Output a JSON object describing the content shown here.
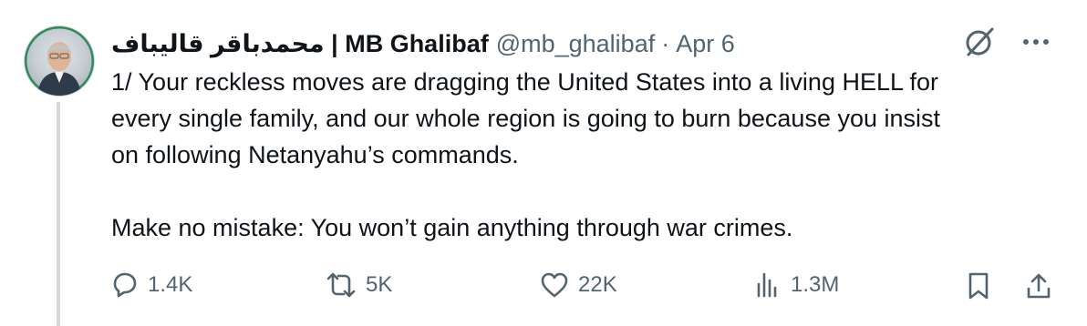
{
  "tweet": {
    "author": {
      "display_name": "محمدباقر قالیباف | MB Ghalibaf",
      "handle": "@mb_ghalibaf",
      "separator": "·",
      "date": "Apr 6"
    },
    "body": [
      "1/ Your reckless moves are dragging the United States into a living HELL for\nevery single family, and our whole region is going to burn because you insist\non following Netanyahu’s commands.",
      "Make no mistake: You won’t gain anything through war crimes."
    ],
    "stats": {
      "replies": "1.4K",
      "reposts": "5K",
      "likes": "22K",
      "views": "1.3M"
    },
    "icons": {
      "header": [
        "grok-icon",
        "more-icon"
      ],
      "actions": [
        "reply-icon",
        "repost-icon",
        "like-icon",
        "views-icon",
        "bookmark-icon",
        "share-icon"
      ]
    },
    "colors": {
      "text": "#0f1419",
      "secondary": "#536471",
      "thread_line": "#cfd9de",
      "avatar_frame": "#2e8b57"
    }
  }
}
